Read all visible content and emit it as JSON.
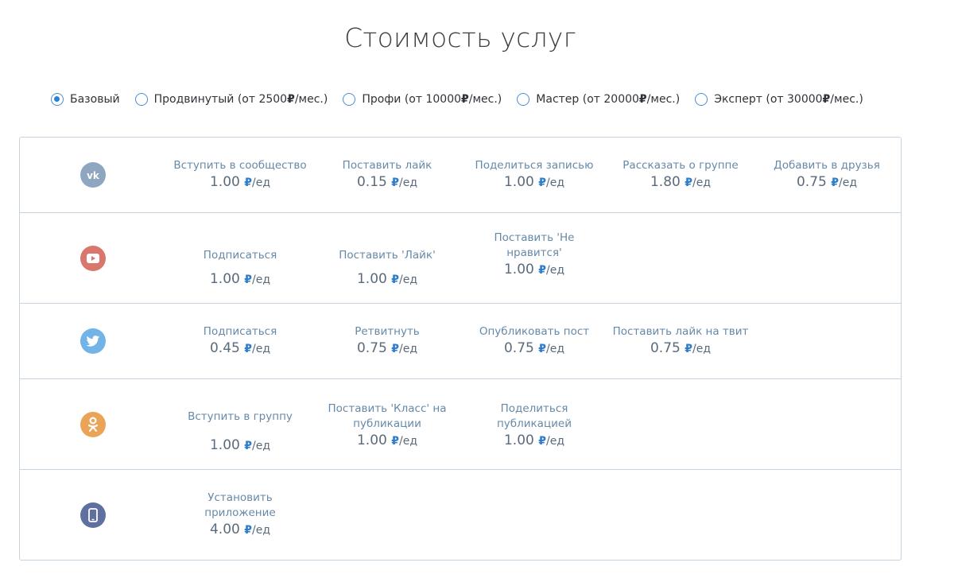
{
  "page": {
    "title": "Стоимость услуг"
  },
  "plans": [
    {
      "label": "Базовый",
      "suffix": "",
      "checked": true
    },
    {
      "label": "Продвинутый (от 2500",
      "suffix": "/мес.)",
      "checked": false
    },
    {
      "label": "Профи (от 10000",
      "suffix": "/мес.)",
      "checked": false
    },
    {
      "label": "Мастер (от 20000",
      "suffix": "/мес.)",
      "checked": false
    },
    {
      "label": "Эксперт (от 30000",
      "suffix": "/мес.)",
      "checked": false
    }
  ],
  "currency": {
    "symbol": "₽",
    "unit": "/ед"
  },
  "rows": [
    {
      "service": "vk",
      "icon": "vk-icon",
      "color": "#8fa6c0",
      "cells": [
        {
          "label": "Вступить в сообщество",
          "price": "1.00"
        },
        {
          "label": "Поставить лайк",
          "price": "0.15"
        },
        {
          "label": "Поделиться записью",
          "price": "1.00"
        },
        {
          "label": "Рассказать о группе",
          "price": "1.80"
        },
        {
          "label": "Добавить в друзья",
          "price": "0.75"
        }
      ]
    },
    {
      "service": "youtube",
      "icon": "youtube-icon",
      "color": "#d9776e",
      "cells": [
        {
          "label": "Подписаться",
          "price": "1.00"
        },
        {
          "label": "Поставить 'Лайк'",
          "price": "1.00"
        },
        {
          "label": "Поставить 'Не нравится'",
          "price": "1.00"
        }
      ]
    },
    {
      "service": "twitter",
      "icon": "twitter-icon",
      "color": "#72b4e8",
      "cells": [
        {
          "label": "Подписаться",
          "price": "0.45"
        },
        {
          "label": "Ретвитнуть",
          "price": "0.75"
        },
        {
          "label": "Опубликовать пост",
          "price": "0.75"
        },
        {
          "label": "Поставить лайк на твит",
          "price": "0.75"
        }
      ]
    },
    {
      "service": "odnoklassniki",
      "icon": "odnoklassniki-icon",
      "color": "#eba457",
      "cells": [
        {
          "label": "Вступить в группу",
          "price": "1.00"
        },
        {
          "label": "Поставить 'Класс' на публикации",
          "price": "1.00"
        },
        {
          "label": "Поделиться публикацией",
          "price": "1.00"
        }
      ]
    },
    {
      "service": "app",
      "icon": "smartphone-icon",
      "color": "#5f6fa0",
      "cells": [
        {
          "label": "Установить приложение",
          "price": "4.00"
        }
      ]
    }
  ]
}
